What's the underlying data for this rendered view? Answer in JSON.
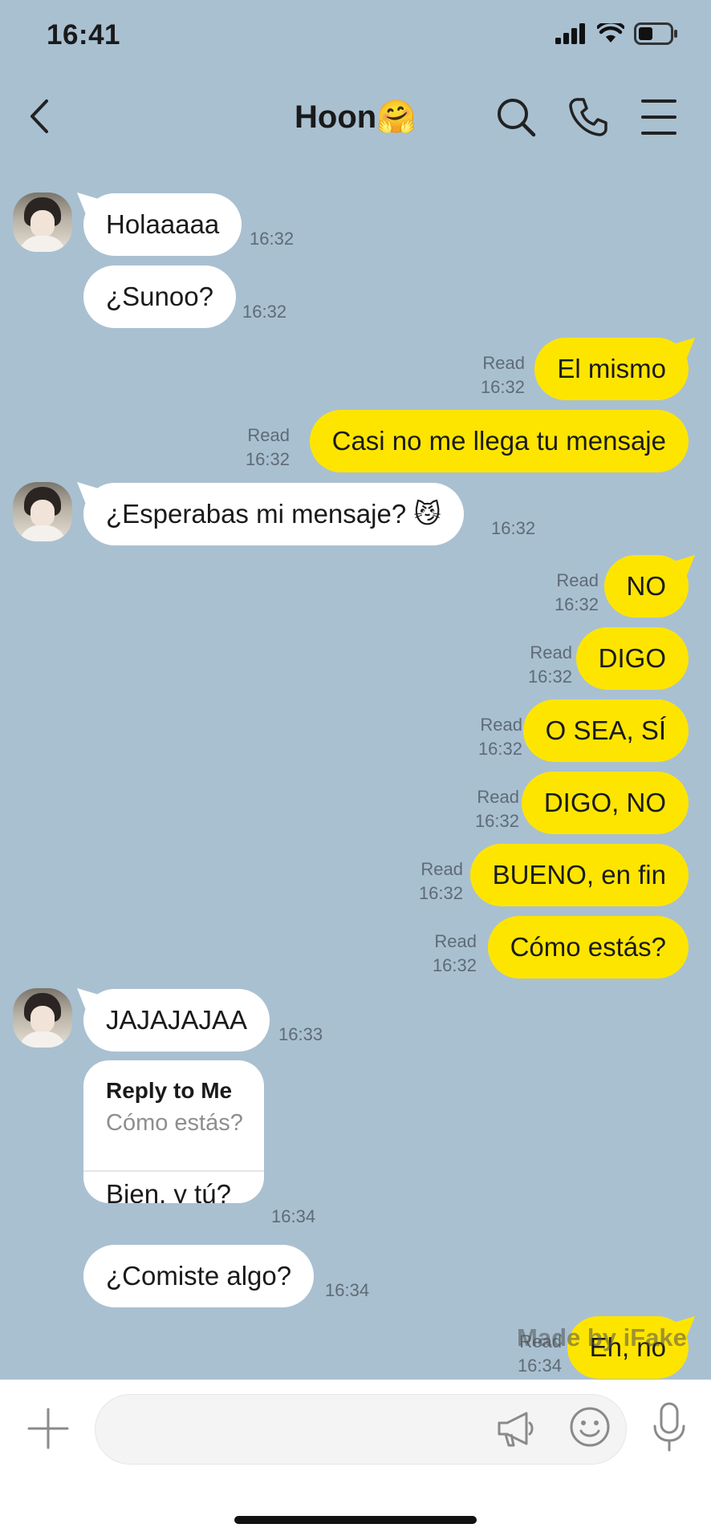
{
  "status_bar": {
    "time": "16:41"
  },
  "header": {
    "title": "Hoon",
    "title_emoji": "🤗"
  },
  "messages": [
    {
      "dir": "in",
      "text": "Holaaaaa",
      "time": "16:32"
    },
    {
      "dir": "in",
      "text": "¿Sunoo?",
      "time": "16:32"
    },
    {
      "dir": "out",
      "text": "El mismo",
      "status": "Read",
      "time": "16:32"
    },
    {
      "dir": "out",
      "text": "Casi no me llega tu mensaje",
      "status": "Read",
      "time": "16:32"
    },
    {
      "dir": "in",
      "text": "¿Esperabas mi mensaje? 😼",
      "time": "16:32"
    },
    {
      "dir": "out",
      "text": "NO",
      "status": "Read",
      "time": "16:32"
    },
    {
      "dir": "out",
      "text": "DIGO",
      "status": "Read",
      "time": "16:32"
    },
    {
      "dir": "out",
      "text": "O SEA, SÍ",
      "status": "Read",
      "time": "16:32"
    },
    {
      "dir": "out",
      "text": "DIGO, NO",
      "status": "Read",
      "time": "16:32"
    },
    {
      "dir": "out",
      "text": "BUENO, en fin",
      "status": "Read",
      "time": "16:32"
    },
    {
      "dir": "out",
      "text": "Cómo estás?",
      "status": "Read",
      "time": "16:32"
    },
    {
      "dir": "in",
      "text": "JAJAJAJAA",
      "time": "16:33"
    },
    {
      "dir": "in",
      "reply_header": "Reply to Me",
      "reply_quote": "Cómo estás?",
      "text": "Bien, y tú?",
      "time": "16:34"
    },
    {
      "dir": "in",
      "text": "¿Comiste algo?",
      "time": "16:34"
    },
    {
      "dir": "out",
      "text": "Eh, no",
      "status": "Read",
      "time": "16:34"
    }
  ],
  "watermark": "Made by iFake",
  "input": {
    "value": "",
    "placeholder": ""
  },
  "icons": [
    "back-icon",
    "search-icon",
    "phone-icon",
    "menu-icon",
    "plus-icon",
    "megaphone-icon",
    "emoji-icon",
    "microphone-icon"
  ],
  "colors": {
    "background": "#a9c0d1",
    "outgoing_bubble": "#fee500",
    "incoming_bubble": "#ffffff"
  }
}
